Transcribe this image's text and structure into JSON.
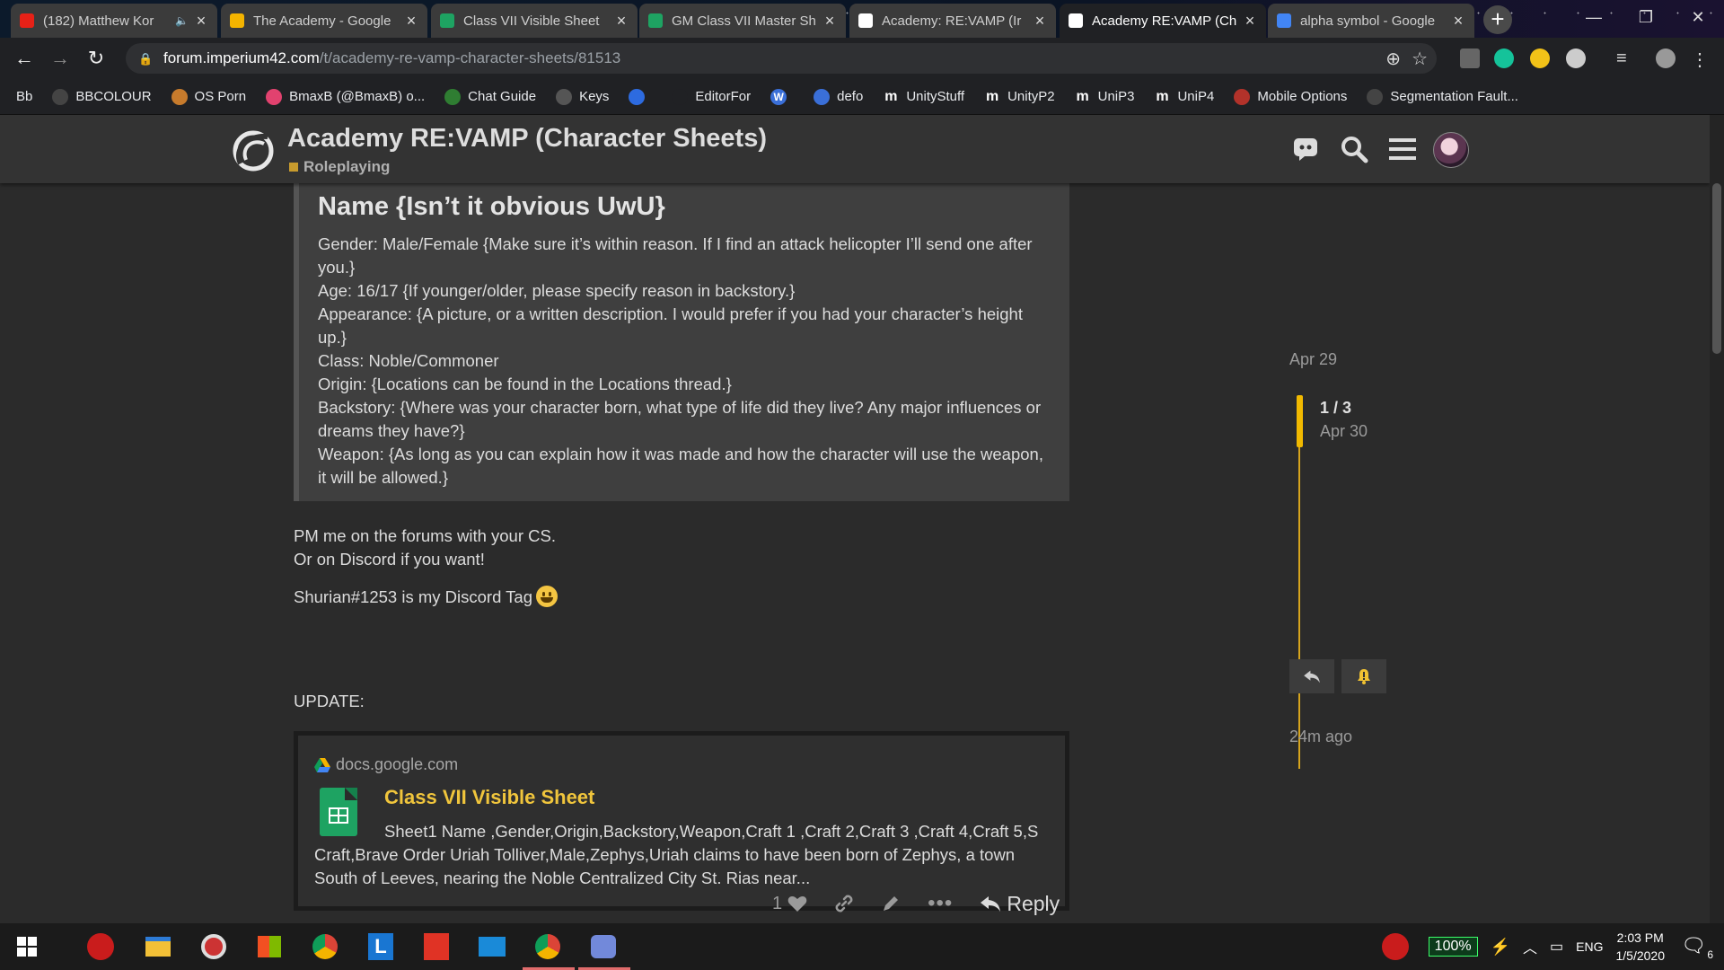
{
  "browser": {
    "tabs": [
      {
        "title": "(182) Matthew Kor",
        "favicon": "youtube-icon",
        "color": "#e62117",
        "active": false,
        "audio": true
      },
      {
        "title": "The Academy - Google",
        "favicon": "drive-icon",
        "color": "#f4b400",
        "active": false
      },
      {
        "title": "Class VII Visible Sheet",
        "favicon": "sheets-icon",
        "color": "#1ea362",
        "active": false
      },
      {
        "title": "GM Class VII Master Sh",
        "favicon": "sheets-icon",
        "color": "#1ea362",
        "active": false
      },
      {
        "title": "Academy: RE:VAMP (Ir",
        "favicon": "forum-icon",
        "color": "#ffffff",
        "active": false
      },
      {
        "title": "Academy RE:VAMP (Ch",
        "favicon": "forum-icon",
        "color": "#ffffff",
        "active": true
      },
      {
        "title": "alpha symbol - Google",
        "favicon": "google-icon",
        "color": "#4285f4",
        "active": false
      }
    ],
    "url_host": "forum.imperium42.com",
    "url_path": "/t/academy-re-vamp-character-sheets/81513",
    "bookmarks": [
      {
        "label": "Bb",
        "icon": "bb-icon",
        "color": "#202124"
      },
      {
        "label": "BBCOLOUR",
        "icon": "globe-icon",
        "color": "#444"
      },
      {
        "label": "OS Porn",
        "icon": "bookmark-icon",
        "color": "#c77b2c"
      },
      {
        "label": "BmaxB (@BmaxB) o...",
        "icon": "heart-icon",
        "color": "#e2426f"
      },
      {
        "label": "Chat Guide",
        "icon": "chat-icon",
        "color": "#2f7d32"
      },
      {
        "label": "Keys",
        "icon": "key-icon",
        "color": "#555"
      },
      {
        "label": "",
        "icon": "cloud-icon",
        "color": "#2d6be0"
      },
      {
        "label": "EditorFor",
        "icon": "editor-icon",
        "color": "#202124"
      },
      {
        "label": "",
        "icon": "wb-icon",
        "color": "#3a6fd8"
      },
      {
        "label": "defo",
        "icon": "defo-icon",
        "color": "#3a6fd8"
      },
      {
        "label": "UnityStuff",
        "icon": "m-icon",
        "color": "#202124"
      },
      {
        "label": "UnityP2",
        "icon": "m-icon",
        "color": "#202124"
      },
      {
        "label": "UniP3",
        "icon": "m-icon",
        "color": "#202124"
      },
      {
        "label": "UniP4",
        "icon": "m-icon",
        "color": "#202124"
      },
      {
        "label": "Mobile Options",
        "icon": "mobile-icon",
        "color": "#b2322a"
      },
      {
        "label": "Segmentation Fault...",
        "icon": "globe-icon",
        "color": "#444"
      }
    ]
  },
  "header": {
    "title": "Academy RE:VAMP (Character Sheets)",
    "category": "Roleplaying",
    "category_color": "#c89b2d"
  },
  "post": {
    "quote": {
      "heading": "Name {Isn’t it obvious UwU}",
      "lines": [
        "Gender: Male/Female {Make sure it’s within reason. If I find an attack helicopter I’ll send one after you.}",
        "Age: 16/17 {If younger/older, please specify reason in backstory.}",
        "Appearance: {A picture, or a written description. I would prefer if you had your character’s height up.}",
        "Class: Noble/Commoner",
        "Origin: {Locations can be found in the Locations thread.}",
        "Backstory: {Where was your character born, what type of life did they live? Any major influences or dreams they have?}",
        "Weapon: {As long as you can explain how it was made and how the character will use the weapon, it will be allowed.}"
      ]
    },
    "pm_line1": "PM me on the forums with your CS.",
    "pm_line2": "Or on Discord if you want!",
    "discord_line": "Shurian#1253 is my Discord Tag",
    "update_label": "UPDATE:",
    "onebox": {
      "source": "docs.google.com",
      "title": "Class VII Visible Sheet",
      "body": "Sheet1 Name ,Gender,Origin,Backstory,Weapon,Craft 1 ,Craft 2,Craft 3 ,Craft 4,Craft 5,S Craft,Brave Order Uriah Tolliver,Male,Zephys,Uriah claims to have been born of Zephys, a town South of Leeves, nearing the Noble Centralized City St. Rias near..."
    },
    "like_count": "1",
    "reply_label": "Reply"
  },
  "timeline": {
    "start_date": "Apr 29",
    "position": "1 / 3",
    "position_date": "Apr 30",
    "end_date": "24m ago"
  },
  "taskbar": {
    "battery": "100%",
    "language": "ENG",
    "time": "2:03 PM",
    "date": "1/5/2020",
    "notifications": "6"
  }
}
